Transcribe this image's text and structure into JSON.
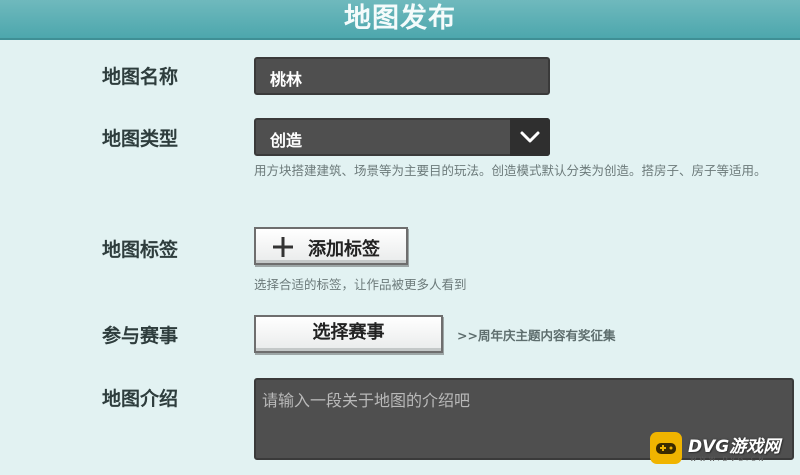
{
  "header": {
    "title": "地图发布"
  },
  "form": {
    "name": {
      "label": "地图名称",
      "value": "桃林"
    },
    "type": {
      "label": "地图类型",
      "value": "创造",
      "hint": "用方块搭建建筑、场景等为主要目的玩法。创造模式默认分类为创造。搭房子、房子等适用。"
    },
    "tags": {
      "label": "地图标签",
      "button": "添加标签",
      "hint": "选择合适的标签，让作品被更多人看到"
    },
    "contest": {
      "label": "参与赛事",
      "button": "选择赛事",
      "note": ">>周年庆主题内容有奖征集"
    },
    "intro": {
      "label": "地图介绍",
      "placeholder": "请输入一段关于地图的介绍吧"
    }
  },
  "watermark": {
    "brand": "DVG游戏网",
    "sub": "WWW.DVG.CN"
  },
  "icons": {
    "dropdown": "chevron-down-icon",
    "add": "plus-icon",
    "watermark": "gamepad-icon"
  },
  "colors": {
    "header": "#4da7ad",
    "background": "#e2f2f2",
    "field": "#4f4f4f",
    "watermark_badge": "#f0b400"
  }
}
